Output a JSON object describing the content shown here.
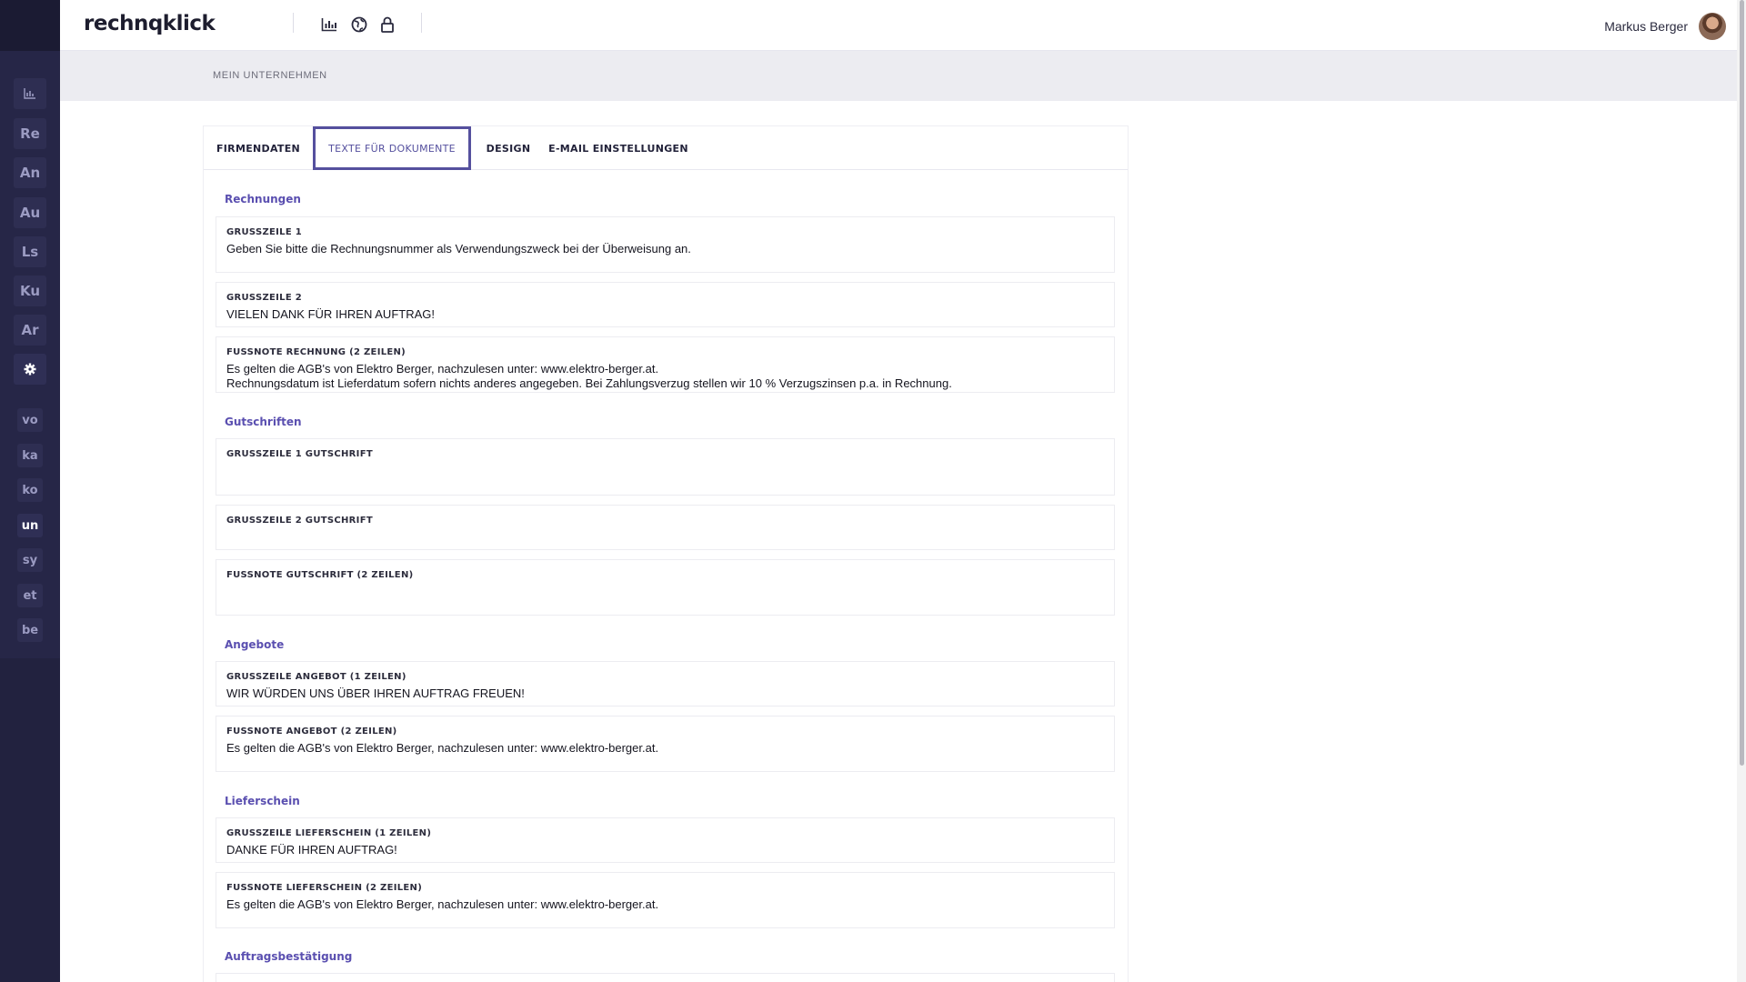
{
  "app": {
    "logo": "rechnqklick"
  },
  "header": {
    "icons": [
      "chart-icon",
      "globe-icon",
      "lock-icon"
    ],
    "user_name": "Markus Berger"
  },
  "sidebar": {
    "main_items": [
      "Re",
      "An",
      "Au",
      "Ls",
      "Ku",
      "Ar"
    ],
    "sub_items": [
      "vo",
      "ka",
      "ko",
      "un",
      "sy",
      "et",
      "be"
    ],
    "active_sub": "un"
  },
  "breadcrumb": "MEIN UNTERNEHMEN",
  "tabs": [
    {
      "label": "FIRMENDATEN"
    },
    {
      "label": "TEXTE FÜR DOKUMENTE",
      "active": true
    },
    {
      "label": "DESIGN"
    },
    {
      "label": "E-MAIL EINSTELLUNGEN"
    }
  ],
  "sections": {
    "rechnungen": {
      "title": "Rechnungen",
      "fields": [
        {
          "label": "GRUSSZEILE 1",
          "value": "Geben Sie bitte die Rechnungsnummer als Verwendungszweck bei der Überweisung an."
        },
        {
          "label": "GRUSSZEILE 2",
          "value": "VIELEN DANK FÜR IHREN AUFTRAG!"
        },
        {
          "label": "FUSSNOTE RECHNUNG (2 ZEILEN)",
          "value": "Es gelten die AGB's von Elektro Berger, nachzulesen unter: www.elektro-berger.at.\nRechnungsdatum ist Lieferdatum sofern nichts anderes angegeben. Bei Zahlungsverzug stellen wir 10 % Verzugszinsen p.a. in Rechnung."
        }
      ]
    },
    "gutschriften": {
      "title": "Gutschriften",
      "fields": [
        {
          "label": "GRUSSZEILE 1 GUTSCHRIFT",
          "value": ""
        },
        {
          "label": "GRUSSZEILE 2 GUTSCHRIFT",
          "value": ""
        },
        {
          "label": "FUSSNOTE GUTSCHRIFT (2 ZEILEN)",
          "value": ""
        }
      ]
    },
    "angebote": {
      "title": "Angebote",
      "fields": [
        {
          "label": "GRUSSZEILE ANGEBOT (1 ZEILEN)",
          "value": "WIR WÜRDEN UNS ÜBER IHREN AUFTRAG FREUEN!"
        },
        {
          "label": "FUSSNOTE ANGEBOT (2 ZEILEN)",
          "value": "Es gelten die AGB's von Elektro Berger, nachzulesen unter: www.elektro-berger.at."
        }
      ]
    },
    "lieferschein": {
      "title": "Lieferschein",
      "fields": [
        {
          "label": "GRUSSZEILE LIEFERSCHEIN (1 ZEILEN)",
          "value": "DANKE FÜR IHREN AUFTRAG!"
        },
        {
          "label": "FUSSNOTE LIEFERSCHEIN (2 ZEILEN)",
          "value": "Es gelten die AGB's von Elektro Berger, nachzulesen unter: www.elektro-berger.at."
        }
      ]
    },
    "auftragsbestaetigung": {
      "title": "Auftragsbestätigung",
      "fields": []
    }
  },
  "colors": {
    "accent": "#5a4fb0",
    "sidebar": "#22223f",
    "crumb_bar": "#ececf1"
  }
}
